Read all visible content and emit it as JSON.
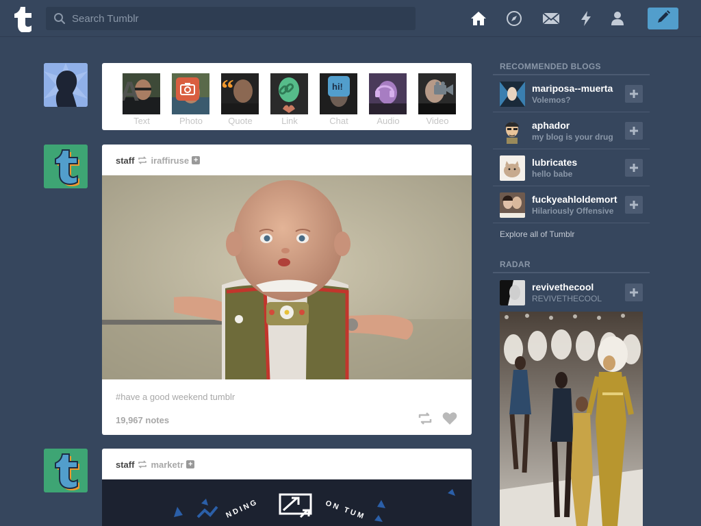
{
  "search": {
    "placeholder": "Search Tumblr"
  },
  "nav": [
    "home-icon",
    "compass-icon",
    "mail-icon",
    "lightning-icon",
    "account-icon"
  ],
  "post_types": [
    {
      "label": "Text",
      "icon": "text-icon",
      "color": "#444444"
    },
    {
      "label": "Photo",
      "icon": "camera-icon",
      "color": "#d95e40"
    },
    {
      "label": "Quote",
      "icon": "quote-icon",
      "color": "#f2992e"
    },
    {
      "label": "Link",
      "icon": "link-icon",
      "color": "#56bc8a"
    },
    {
      "label": "Chat",
      "icon": "chat-icon",
      "color": "#529ecc"
    },
    {
      "label": "Audio",
      "icon": "headphones-icon",
      "color": "#a77dc2"
    },
    {
      "label": "Video",
      "icon": "video-icon",
      "color": "#748089"
    }
  ],
  "posts": [
    {
      "author": "staff",
      "source": "iraffiruse",
      "tags": "#have a good weekend tumblr",
      "notes": "19,967 notes"
    },
    {
      "author": "staff",
      "source": "marketr",
      "graphic_text": "NDING ON TUM"
    }
  ],
  "sidebar": {
    "recommended_title": "RECOMMENDED BLOGS",
    "blogs": [
      {
        "name": "mariposa--muerta",
        "desc": "Volemos?"
      },
      {
        "name": "aphador",
        "desc": "my blog is your drug"
      },
      {
        "name": "lubricates",
        "desc": "hello babe"
      },
      {
        "name": "fuckyeahloldemort",
        "desc": "Hilariously Offensive"
      }
    ],
    "explore": "Explore all of Tumblr",
    "radar_title": "RADAR",
    "radar": {
      "name": "revivethecool",
      "desc": "REVIVETHECOOL"
    }
  },
  "colors": {
    "background": "#36465d",
    "compose": "#529ecc",
    "staff_avatar": "#3ea574"
  }
}
